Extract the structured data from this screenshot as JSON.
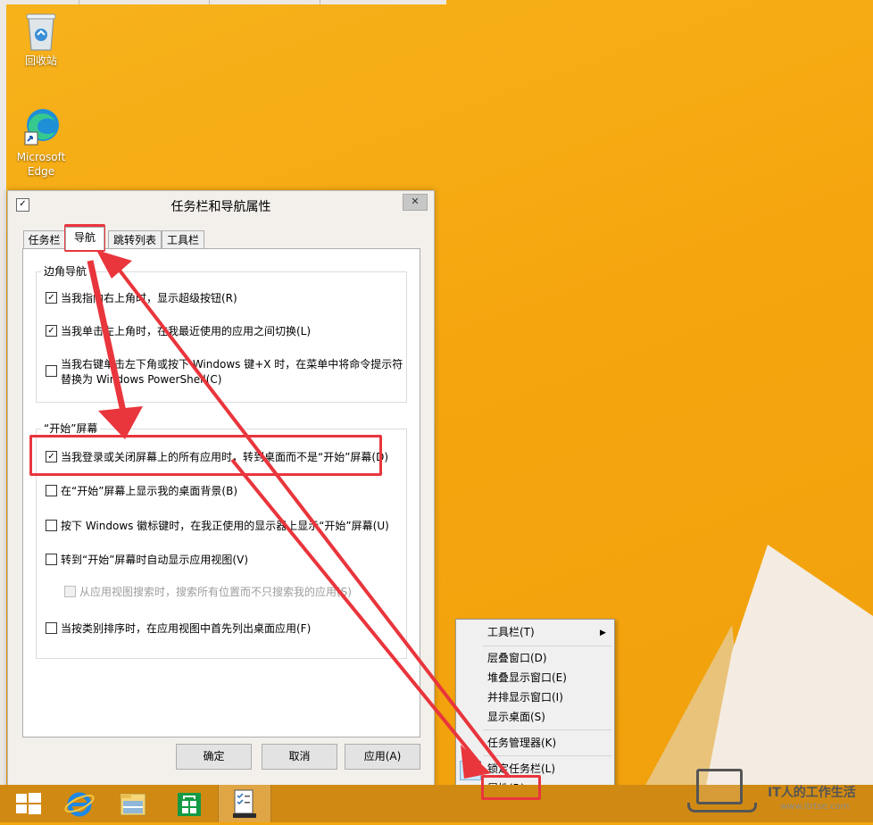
{
  "desktop": {
    "icons": [
      {
        "label": "回收站"
      },
      {
        "label": "Microsoft Edge"
      }
    ]
  },
  "dialog": {
    "title": "任务栏和导航属性",
    "tabs": [
      "任务栏",
      "导航",
      "跳转列表",
      "工具栏"
    ],
    "active_tab": "导航",
    "corner_group": {
      "title": "边角导航",
      "options": [
        {
          "label": "当我指向右上角时，显示超级按钮(R)",
          "checked": true
        },
        {
          "label": "当我单击左上角时，在我最近使用的应用之间切换(L)",
          "checked": true
        },
        {
          "label_line1": "当我右键单击左下角或按下 Windows 键+X 时，在菜单中将命令提示符",
          "label_line2": "替换为 Windows PowerShell(C)",
          "checked": false
        }
      ]
    },
    "start_group": {
      "title": "“开始”屏幕",
      "options": [
        {
          "label": "当我登录或关闭屏幕上的所有应用时，转到桌面而不是“开始”屏幕(D)",
          "checked": true
        },
        {
          "label": "在“开始”屏幕上显示我的桌面背景(B)",
          "checked": false
        },
        {
          "label": "按下 Windows 徽标键时，在我正使用的显示器上显示“开始”屏幕(U)",
          "checked": false
        },
        {
          "label": "转到“开始”屏幕时自动显示应用视图(V)",
          "checked": false
        },
        {
          "label": "从应用视图搜索时，搜索所有位置而不只搜索我的应用(S)",
          "checked": false,
          "disabled": true
        },
        {
          "label": "当按类别排序时，在应用视图中首先列出桌面应用(F)",
          "checked": false
        }
      ]
    },
    "buttons": {
      "ok": "确定",
      "cancel": "取消",
      "apply": "应用(A)"
    }
  },
  "context_menu": {
    "items": [
      "工具栏(T)",
      "层叠窗口(D)",
      "堆叠显示窗口(E)",
      "并排显示窗口(I)",
      "显示桌面(S)",
      "任务管理器(K)",
      "锁定任务栏(L)",
      "属性(R)"
    ],
    "checked_item": "锁定任务栏(L)"
  },
  "watermark": {
    "title": "IT人的工作生活",
    "url": "www.itrtse.com"
  },
  "colors": {
    "desktop": "#f5a60f",
    "highlight": "#e9353c",
    "taskbar": "#d08a14"
  }
}
